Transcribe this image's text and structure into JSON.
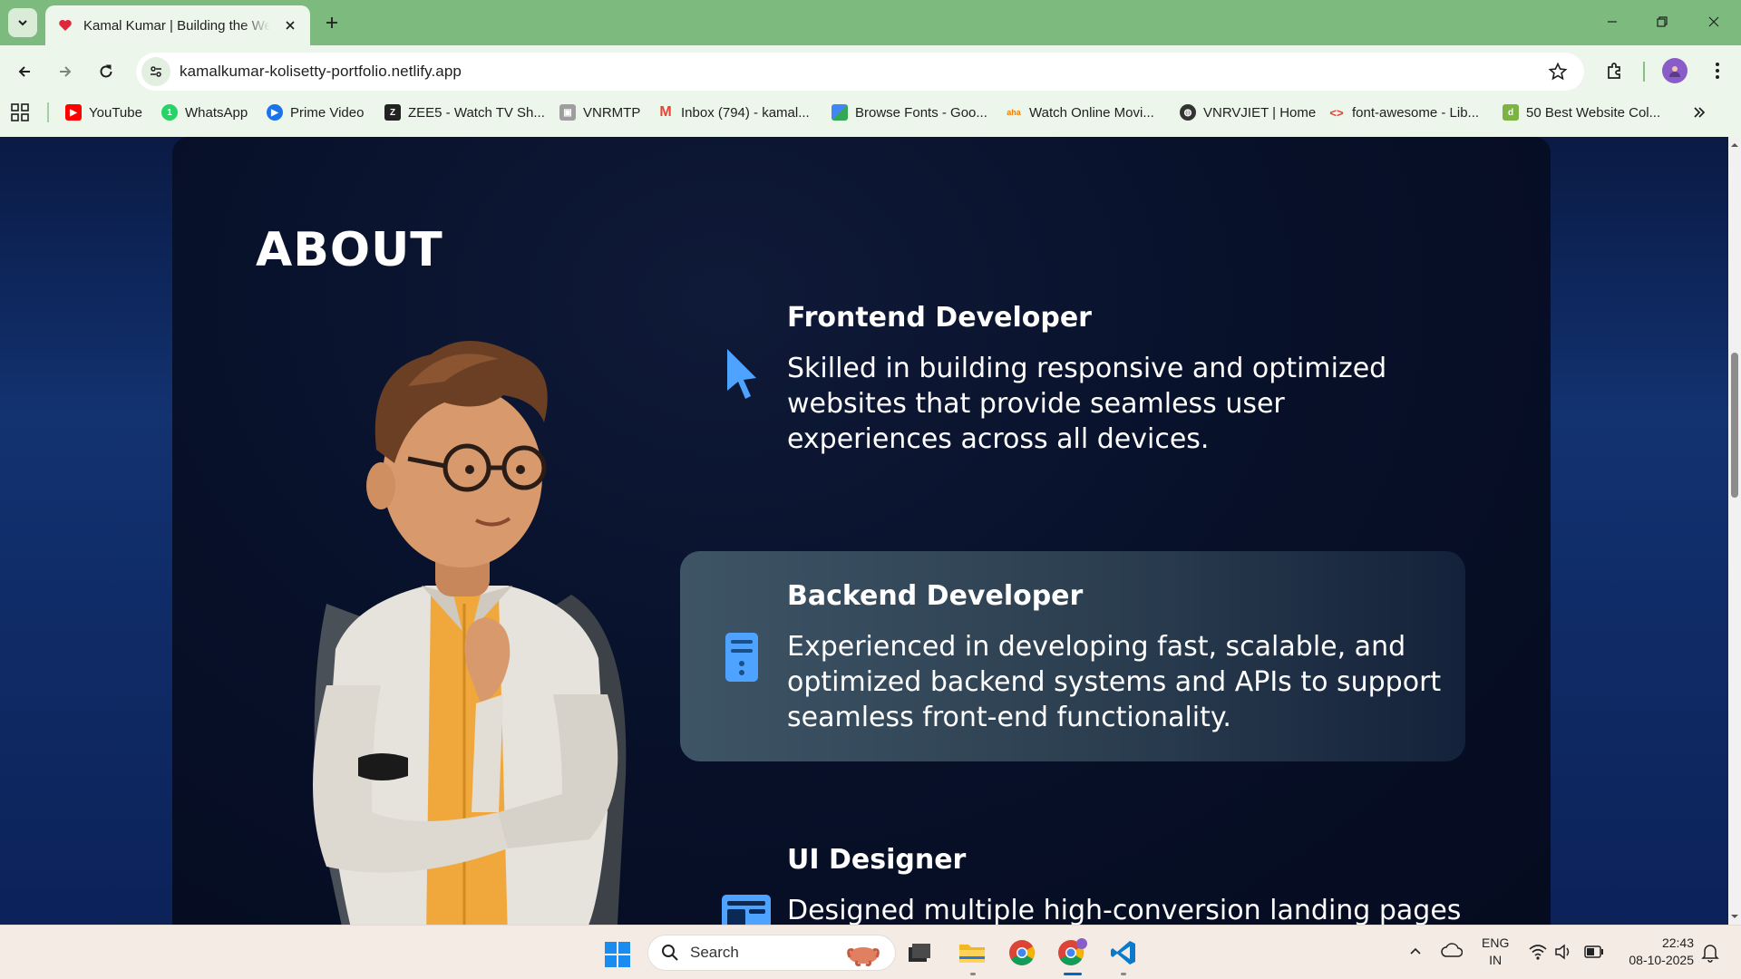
{
  "browser": {
    "tab": {
      "title": "Kamal Kumar | Building the Web"
    },
    "url": "kamalkumar-kolisetty-portfolio.netlify.app",
    "bookmarks": [
      {
        "label": "YouTube",
        "icon": "youtube-icon",
        "color": "#ff0000"
      },
      {
        "label": "WhatsApp",
        "icon": "whatsapp-icon",
        "color": "#25d366"
      },
      {
        "label": "Prime Video",
        "icon": "prime-video-icon",
        "color": "#1a73e8"
      },
      {
        "label": "ZEE5 - Watch TV Sh...",
        "icon": "zee5-icon",
        "color": "#222222"
      },
      {
        "label": "VNRMTP",
        "icon": "vnrmtp-icon",
        "color": "#9e9e9e"
      },
      {
        "label": "Inbox (794) - kamal...",
        "icon": "gmail-icon",
        "color": "#ea4335"
      },
      {
        "label": "Browse Fonts - Goo...",
        "icon": "google-fonts-icon",
        "color": "#4285f4"
      },
      {
        "label": "Watch Online Movi...",
        "icon": "movies-icon",
        "color": "#f57c00"
      },
      {
        "label": "VNRVJIET | Home",
        "icon": "globe-icon",
        "color": "#333333"
      },
      {
        "label": "font-awesome - Lib...",
        "icon": "code-icon",
        "color": "#e53935"
      },
      {
        "label": "50 Best Website Col...",
        "icon": "design-icon",
        "color": "#7cb342"
      }
    ]
  },
  "page": {
    "section_title": "ABOUT",
    "services": [
      {
        "title": "Frontend Developer",
        "description": "Skilled in building responsive and optimized websites that provide seamless user experiences across all devices.",
        "icon": "cursor-icon"
      },
      {
        "title": "Backend Developer",
        "description": "Experienced in developing fast, scalable, and optimized backend systems and APIs to support seamless front-end functionality.",
        "icon": "server-icon"
      },
      {
        "title": "UI Designer",
        "description": "Designed multiple high-conversion landing pages",
        "icon": "layout-icon"
      }
    ],
    "accent_color": "#4da3ff"
  },
  "taskbar": {
    "search_label": "Search",
    "lang_top": "ENG",
    "lang_bottom": "IN",
    "time": "22:43",
    "date": "08-10-2025"
  }
}
